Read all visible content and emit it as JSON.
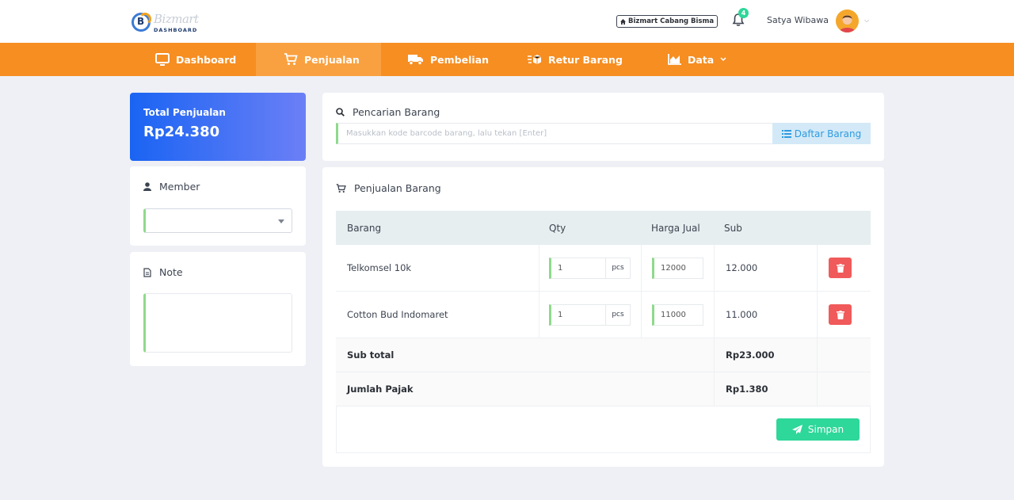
{
  "header": {
    "logo_brand": "Bizmart",
    "logo_sub": "DASHBOARD",
    "logo_letter": "B",
    "branch_label": "Bizmart Cabang Bisma",
    "notification_count": "4",
    "user_name": "Satya Wibawa"
  },
  "nav": {
    "items": [
      {
        "label": "Dashboard",
        "icon": "monitor-icon"
      },
      {
        "label": "Penjualan",
        "icon": "cart-icon",
        "active": true
      },
      {
        "label": "Pembelian",
        "icon": "truck-icon"
      },
      {
        "label": "Retur Barang",
        "icon": "return-box-icon"
      },
      {
        "label": "Data",
        "icon": "area-chart-icon",
        "dropdown": true
      }
    ]
  },
  "total": {
    "label": "Total Penjualan",
    "value": "Rp24.380"
  },
  "member": {
    "title": "Member",
    "selected": ""
  },
  "note": {
    "title": "Note",
    "value": ""
  },
  "search": {
    "title": "Pencarian Barang",
    "placeholder": "Masukkan kode barcode barang, lalu tekan [Enter]",
    "button_label": "Daftar Barang"
  },
  "sales": {
    "title": "Penjualan Barang",
    "columns": [
      "Barang",
      "Qty",
      "Harga Jual",
      "Sub"
    ],
    "rows": [
      {
        "name": "Telkomsel 10k",
        "qty": "1",
        "unit": "pcs",
        "price": "12000",
        "sub": "12.000"
      },
      {
        "name": "Cotton Bud Indomaret",
        "qty": "1",
        "unit": "pcs",
        "price": "11000",
        "sub": "11.000"
      }
    ],
    "subtotal_label": "Sub total",
    "subtotal_value": "Rp23.000",
    "tax_label": "Jumlah Pajak",
    "tax_value": "Rp1.380",
    "save_label": "Simpan"
  },
  "colors": {
    "nav_bg": "#f68e22",
    "nav_active": "#f9a140",
    "accent_green": "#2ed79a",
    "danger": "#f15a5a",
    "total_gradient_start": "#1a64f3",
    "total_gradient_end": "#6b7ff6"
  }
}
